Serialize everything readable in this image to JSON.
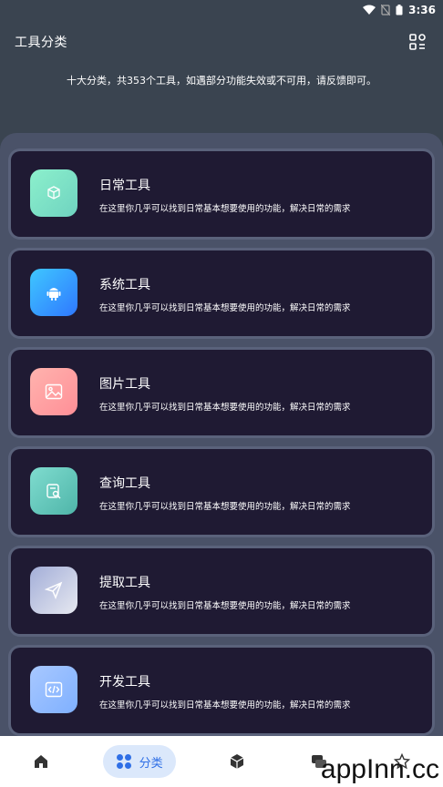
{
  "status_bar": {
    "time": "3:36"
  },
  "header": {
    "title": "工具分类"
  },
  "subtitle": "十大分类，共353个工具，如遇部分功能失效或不可用，请反馈即可。",
  "categories": [
    {
      "title": "日常工具",
      "desc": "在这里你几乎可以找到日常基本想要使用的功能，解决日常的需求",
      "icon": "cube-icon",
      "colors": [
        "#8cf0cc",
        "#6fd3c0"
      ]
    },
    {
      "title": "系统工具",
      "desc": "在这里你几乎可以找到日常基本想要使用的功能，解决日常的需求",
      "icon": "android-icon",
      "colors": [
        "#3fc7ff",
        "#2f78ff"
      ]
    },
    {
      "title": "图片工具",
      "desc": "在这里你几乎可以找到日常基本想要使用的功能，解决日常的需求",
      "icon": "image-icon",
      "colors": [
        "#ffb3ae",
        "#ff8f97"
      ]
    },
    {
      "title": "查询工具",
      "desc": "在这里你几乎可以找到日常基本想要使用的功能，解决日常的需求",
      "icon": "search-doc-icon",
      "colors": [
        "#7fdccf",
        "#4fb5a9"
      ]
    },
    {
      "title": "提取工具",
      "desc": "在这里你几乎可以找到日常基本想要使用的功能，解决日常的需求",
      "icon": "send-icon",
      "colors": [
        "#a3aed8",
        "#e6e8f0"
      ]
    },
    {
      "title": "开发工具",
      "desc": "在这里你几乎可以找到日常基本想要使用的功能，解决日常的需求",
      "icon": "code-icon",
      "colors": [
        "#a8c8ff",
        "#7fb0ff"
      ]
    }
  ],
  "bottom_nav": {
    "active_label": "分类",
    "items": [
      "home-icon",
      "category-icon",
      "cube-icon",
      "chat-icon",
      "star-icon"
    ]
  },
  "watermark": "appInn.cc"
}
